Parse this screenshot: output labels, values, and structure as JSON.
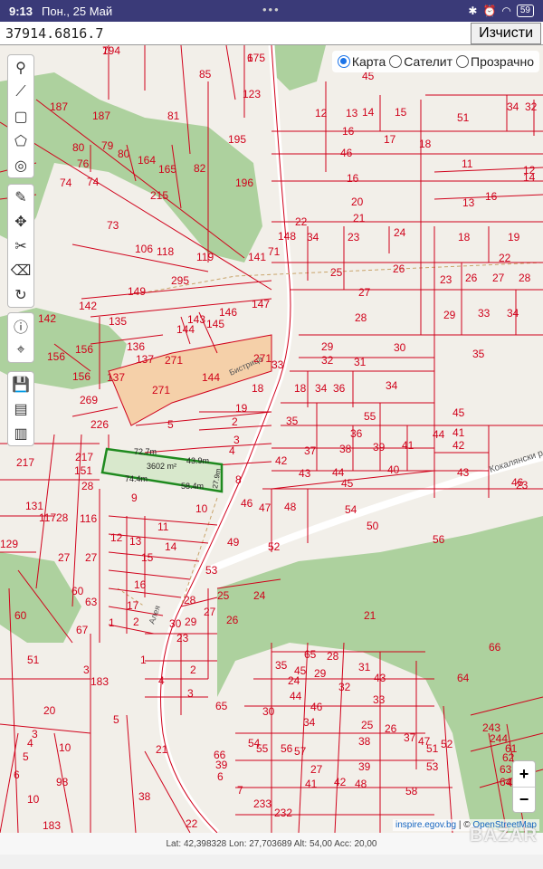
{
  "status_bar": {
    "time": "9:13",
    "date": "Пон., 25 Май",
    "dots": "•••",
    "battery": "59"
  },
  "search": {
    "value": "37914.6816.7",
    "clear_label": "Изчисти"
  },
  "layers": {
    "map": "Карта",
    "satellite": "Сателит",
    "transparent": "Прозрачно",
    "selected": "map"
  },
  "tools": [
    "marker-icon",
    "polyline-icon",
    "rectangle-icon",
    "polygon-icon",
    "circle-icon",
    "pin-edit-icon",
    "move-icon",
    "scissors-icon",
    "eraser-icon",
    "rotate-icon",
    "info-icon",
    "locate-icon",
    "save-icon",
    "shp-icon",
    "json-icon"
  ],
  "map": {
    "streets": {
      "bistritsa": "Бистрица",
      "kokalyanski": "Кокалянски р",
      "aleya": "Алея"
    },
    "parcel": {
      "area": "3602 m²",
      "sides": [
        "72.7m",
        "43.9m",
        "74.4m",
        "58.4m",
        "27.9m"
      ]
    },
    "colors": {
      "line": "#d0021b",
      "green": "#add19e",
      "highlight": "#1f8a1f",
      "orange": "#f5d0a9"
    },
    "labels": [
      {
        "t": "194"
      },
      {
        "t": "175"
      },
      {
        "t": "85"
      },
      {
        "t": "123"
      },
      {
        "t": "187"
      },
      {
        "t": "187"
      },
      {
        "t": "81"
      },
      {
        "t": "79"
      },
      {
        "t": "80"
      },
      {
        "t": "80"
      },
      {
        "t": "76"
      },
      {
        "t": "74"
      },
      {
        "t": "164"
      },
      {
        "t": "165"
      },
      {
        "t": "82"
      },
      {
        "t": "195"
      },
      {
        "t": "196"
      },
      {
        "t": "74"
      },
      {
        "t": "215"
      },
      {
        "t": "73"
      },
      {
        "t": "106"
      },
      {
        "t": "118"
      },
      {
        "t": "119"
      },
      {
        "t": "141"
      },
      {
        "t": "71"
      },
      {
        "t": "148"
      },
      {
        "t": "149"
      },
      {
        "t": "295"
      },
      {
        "t": "147"
      },
      {
        "t": "142"
      },
      {
        "t": "142"
      },
      {
        "t": "143"
      },
      {
        "t": "145"
      },
      {
        "t": "146"
      },
      {
        "t": "135"
      },
      {
        "t": "144"
      },
      {
        "t": "156"
      },
      {
        "t": "156"
      },
      {
        "t": "136"
      },
      {
        "t": "137"
      },
      {
        "t": "271"
      },
      {
        "t": "271"
      },
      {
        "t": "144"
      },
      {
        "t": "271"
      },
      {
        "t": "156"
      },
      {
        "t": "137"
      },
      {
        "t": "269"
      },
      {
        "t": "18"
      },
      {
        "t": "226"
      },
      {
        "t": "5"
      },
      {
        "t": "19"
      },
      {
        "t": "2"
      },
      {
        "t": "3"
      },
      {
        "t": "4"
      },
      {
        "t": "217"
      },
      {
        "t": "217"
      },
      {
        "t": "151"
      },
      {
        "t": "28"
      },
      {
        "t": "8"
      },
      {
        "t": "9"
      },
      {
        "t": "10"
      },
      {
        "t": "131"
      },
      {
        "t": "117"
      },
      {
        "t": "28"
      },
      {
        "t": "116"
      },
      {
        "t": "11"
      },
      {
        "t": "129"
      },
      {
        "t": "27"
      },
      {
        "t": "27"
      },
      {
        "t": "12"
      },
      {
        "t": "13"
      },
      {
        "t": "14"
      },
      {
        "t": "15"
      },
      {
        "t": "16"
      },
      {
        "t": "60"
      },
      {
        "t": "63"
      },
      {
        "t": "17"
      },
      {
        "t": "1"
      },
      {
        "t": "2"
      },
      {
        "t": "28"
      },
      {
        "t": "30"
      },
      {
        "t": "29"
      },
      {
        "t": "27"
      },
      {
        "t": "25"
      },
      {
        "t": "26"
      },
      {
        "t": "24"
      },
      {
        "t": "60"
      },
      {
        "t": "67"
      },
      {
        "t": "51"
      },
      {
        "t": "3"
      },
      {
        "t": "183"
      },
      {
        "t": "23"
      },
      {
        "t": "1"
      },
      {
        "t": "2"
      },
      {
        "t": "4"
      },
      {
        "t": "3"
      },
      {
        "t": "5"
      },
      {
        "t": "20"
      },
      {
        "t": "3"
      },
      {
        "t": "4"
      },
      {
        "t": "5"
      },
      {
        "t": "6"
      },
      {
        "t": "10"
      },
      {
        "t": "98"
      },
      {
        "t": "21"
      },
      {
        "t": "38"
      },
      {
        "t": "39"
      },
      {
        "t": "6"
      },
      {
        "t": "7"
      },
      {
        "t": "233"
      },
      {
        "t": "232"
      },
      {
        "t": "10"
      },
      {
        "t": "183"
      },
      {
        "t": "22"
      },
      {
        "t": "45"
      },
      {
        "t": "12"
      },
      {
        "t": "13"
      },
      {
        "t": "14"
      },
      {
        "t": "15"
      },
      {
        "t": "16"
      },
      {
        "t": "17"
      },
      {
        "t": "18"
      },
      {
        "t": "46"
      },
      {
        "t": "16"
      },
      {
        "t": "20"
      },
      {
        "t": "21"
      },
      {
        "t": "22"
      },
      {
        "t": "34"
      },
      {
        "t": "23"
      },
      {
        "t": "24"
      },
      {
        "t": "25"
      },
      {
        "t": "26"
      },
      {
        "t": "27"
      },
      {
        "t": "28"
      },
      {
        "t": "29"
      },
      {
        "t": "30"
      },
      {
        "t": "32"
      },
      {
        "t": "31"
      },
      {
        "t": "33"
      },
      {
        "t": "18"
      },
      {
        "t": "34"
      },
      {
        "t": "36"
      },
      {
        "t": "34"
      },
      {
        "t": "35"
      },
      {
        "t": "55"
      },
      {
        "t": "36"
      },
      {
        "t": "37"
      },
      {
        "t": "38"
      },
      {
        "t": "39"
      },
      {
        "t": "41"
      },
      {
        "t": "42"
      },
      {
        "t": "43"
      },
      {
        "t": "44"
      },
      {
        "t": "40"
      },
      {
        "t": "45"
      },
      {
        "t": "46"
      },
      {
        "t": "47"
      },
      {
        "t": "48"
      },
      {
        "t": "54"
      },
      {
        "t": "49"
      },
      {
        "t": "52"
      },
      {
        "t": "53"
      },
      {
        "t": "50"
      },
      {
        "t": "56"
      },
      {
        "t": "51"
      },
      {
        "t": "34"
      },
      {
        "t": "32"
      },
      {
        "t": "11"
      },
      {
        "t": "12"
      },
      {
        "t": "13"
      },
      {
        "t": "14"
      },
      {
        "t": "16"
      },
      {
        "t": "18"
      },
      {
        "t": "19"
      },
      {
        "t": "22"
      },
      {
        "t": "23"
      },
      {
        "t": "26"
      },
      {
        "t": "27"
      },
      {
        "t": "28"
      },
      {
        "t": "29"
      },
      {
        "t": "33"
      },
      {
        "t": "34"
      },
      {
        "t": "35"
      },
      {
        "t": "45"
      },
      {
        "t": "41"
      },
      {
        "t": "42"
      },
      {
        "t": "43"
      },
      {
        "t": "44"
      },
      {
        "t": "46"
      },
      {
        "t": "23"
      },
      {
        "t": "21"
      },
      {
        "t": "66"
      },
      {
        "t": "64"
      },
      {
        "t": "65"
      },
      {
        "t": "28"
      },
      {
        "t": "31"
      },
      {
        "t": "43"
      },
      {
        "t": "45"
      },
      {
        "t": "29"
      },
      {
        "t": "32"
      },
      {
        "t": "33"
      },
      {
        "t": "35"
      },
      {
        "t": "44"
      },
      {
        "t": "46"
      },
      {
        "t": "24"
      },
      {
        "t": "30"
      },
      {
        "t": "34"
      },
      {
        "t": "25"
      },
      {
        "t": "26"
      },
      {
        "t": "37"
      },
      {
        "t": "47"
      },
      {
        "t": "51"
      },
      {
        "t": "52"
      },
      {
        "t": "53"
      },
      {
        "t": "54"
      },
      {
        "t": "55"
      },
      {
        "t": "56"
      },
      {
        "t": "57"
      },
      {
        "t": "27"
      },
      {
        "t": "38"
      },
      {
        "t": "39"
      },
      {
        "t": "41"
      },
      {
        "t": "42"
      },
      {
        "t": "48"
      },
      {
        "t": "58"
      },
      {
        "t": "49"
      },
      {
        "t": "243"
      },
      {
        "t": "244"
      },
      {
        "t": "61"
      },
      {
        "t": "62"
      },
      {
        "t": "63"
      },
      {
        "t": "64"
      },
      {
        "t": "65"
      },
      {
        "t": "66"
      },
      {
        "t": "7"
      },
      {
        "t": "6"
      }
    ]
  },
  "attribution": {
    "inspire": "inspire.egov.bg",
    "sep": " | © ",
    "osm": "OpenStreetMap"
  },
  "zoom": {
    "in": "+",
    "out": "−"
  },
  "info": "Lat: 42,398328 Lon: 27,703689 Alt: 54,00 Acc: 20,00",
  "watermark": "BAZAR"
}
